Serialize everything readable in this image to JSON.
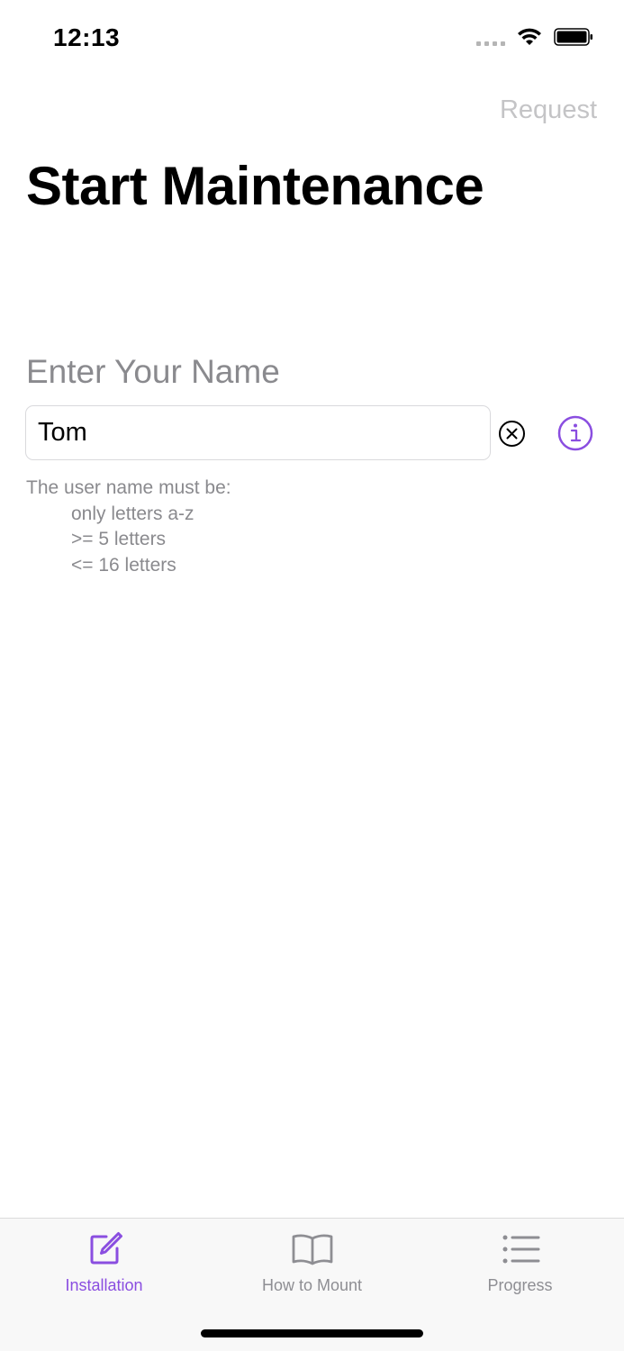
{
  "status_bar": {
    "time": "12:13"
  },
  "nav": {
    "right_action": "Request"
  },
  "page": {
    "title": "Start Maintenance"
  },
  "form": {
    "label": "Enter Your Name",
    "name_value": "Tom",
    "rules_title": "The user name must be:",
    "rules": [
      "only letters a-z",
      ">= 5 letters",
      "<= 16 letters"
    ]
  },
  "tabs": [
    {
      "label": "Installation",
      "icon": "edit-icon",
      "active": true
    },
    {
      "label": "How to Mount",
      "icon": "book-icon",
      "active": false
    },
    {
      "label": "Progress",
      "icon": "list-icon",
      "active": false
    }
  ],
  "colors": {
    "accent": "#8a4ee0",
    "inactive": "#8e8e93"
  }
}
